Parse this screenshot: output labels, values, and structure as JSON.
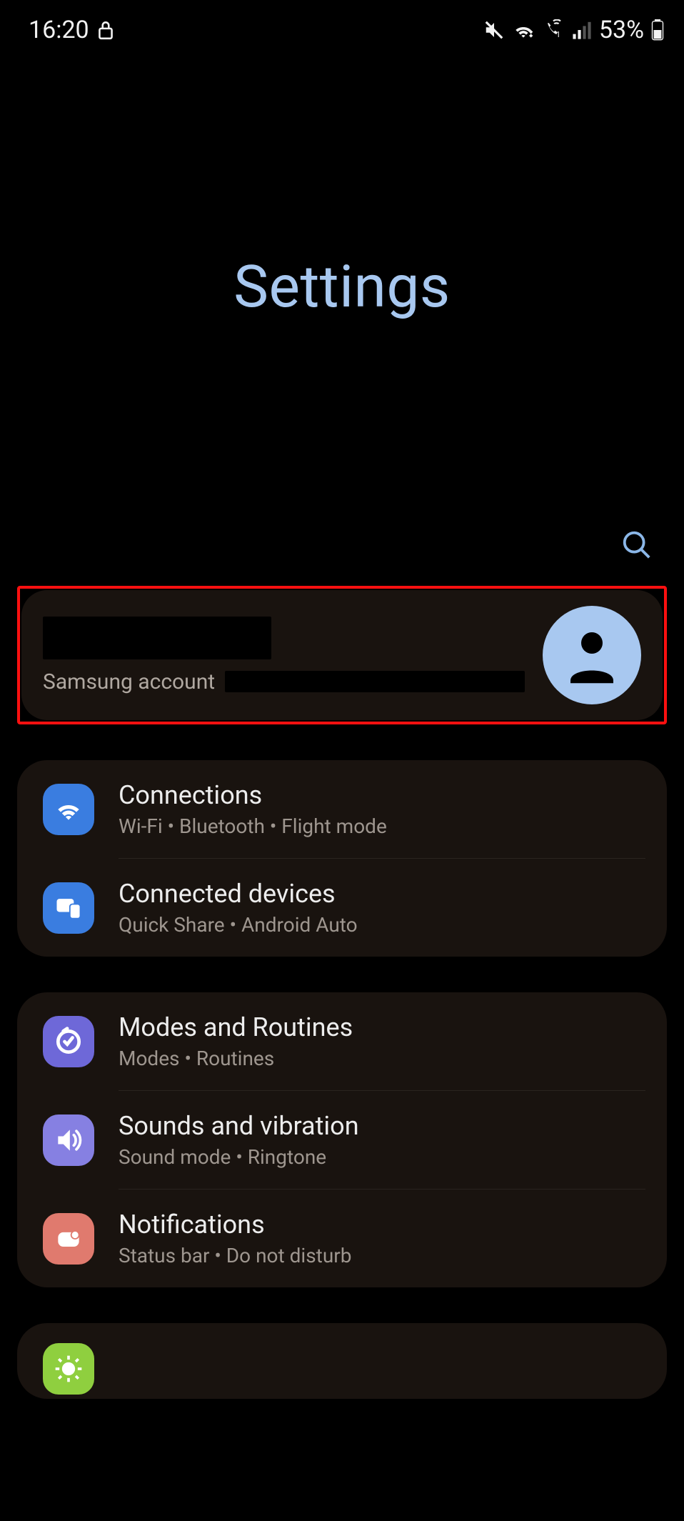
{
  "status": {
    "time": "16:20",
    "battery_pct": "53%"
  },
  "page": {
    "title": "Settings"
  },
  "account": {
    "subtitle": "Samsung account"
  },
  "groups": [
    {
      "items": [
        {
          "icon": "wifi-icon",
          "icon_bg": "ic-blue",
          "title": "Connections",
          "sub": "Wi-Fi  •  Bluetooth  •  Flight mode"
        },
        {
          "icon": "devices-icon",
          "icon_bg": "ic-blue2",
          "title": "Connected devices",
          "sub": "Quick Share  •  Android Auto"
        }
      ]
    },
    {
      "items": [
        {
          "icon": "routines-icon",
          "icon_bg": "ic-purple",
          "title": "Modes and Routines",
          "sub": "Modes  •  Routines"
        },
        {
          "icon": "sound-icon",
          "icon_bg": "ic-purple2",
          "title": "Sounds and vibration",
          "sub": "Sound mode  •  Ringtone"
        },
        {
          "icon": "notifications-icon",
          "icon_bg": "ic-red",
          "title": "Notifications",
          "sub": "Status bar  •  Do not disturb"
        }
      ]
    },
    {
      "items": [
        {
          "icon": "display-icon",
          "icon_bg": "ic-green",
          "title": "",
          "sub": ""
        }
      ]
    }
  ]
}
